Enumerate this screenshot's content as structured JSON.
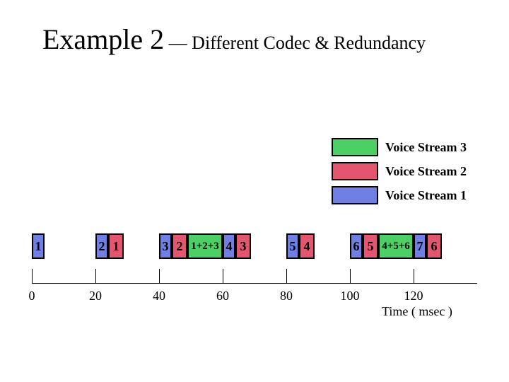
{
  "title_main": "Example 2",
  "title_sep": " — ",
  "title_sub": "Different Codec & Redundancy",
  "legend": [
    {
      "label": "Voice Stream 3",
      "color": "c-green"
    },
    {
      "label": "Voice Stream 2",
      "color": "c-red"
    },
    {
      "label": "Voice Stream 1",
      "color": "c-blue"
    }
  ],
  "axis": {
    "ticks": [
      0,
      20,
      40,
      60,
      80,
      100,
      120
    ],
    "title": "Time ( msec )"
  },
  "chart_data": {
    "type": "table",
    "title": "Packet composition over time — Different Codec & Redundancy",
    "xlabel": "Time ( msec )",
    "ylabel": "",
    "ylim": null,
    "x": [
      0,
      20,
      40,
      60,
      80,
      100,
      120
    ],
    "packets": [
      {
        "time": 0,
        "segments": [
          {
            "stream": 1,
            "label": "1"
          }
        ]
      },
      {
        "time": 20,
        "segments": [
          {
            "stream": 1,
            "label": "2"
          },
          {
            "stream": 2,
            "label": "1"
          }
        ]
      },
      {
        "time": 40,
        "segments": [
          {
            "stream": 1,
            "label": "3"
          },
          {
            "stream": 2,
            "label": "2"
          },
          {
            "stream": 3,
            "label": "1+2+3"
          }
        ]
      },
      {
        "time": 60,
        "segments": [
          {
            "stream": 1,
            "label": "4"
          },
          {
            "stream": 2,
            "label": "3"
          }
        ]
      },
      {
        "time": 80,
        "segments": [
          {
            "stream": 1,
            "label": "5"
          },
          {
            "stream": 2,
            "label": "4"
          }
        ]
      },
      {
        "time": 100,
        "segments": [
          {
            "stream": 1,
            "label": "6"
          },
          {
            "stream": 2,
            "label": "5"
          },
          {
            "stream": 3,
            "label": "4+5+6"
          }
        ]
      },
      {
        "time": 120,
        "segments": [
          {
            "stream": 1,
            "label": "7"
          },
          {
            "stream": 2,
            "label": "6"
          }
        ]
      }
    ],
    "stream_colors": {
      "1": "#6f7fe4",
      "2": "#e4566f",
      "3": "#4ccf64"
    }
  }
}
